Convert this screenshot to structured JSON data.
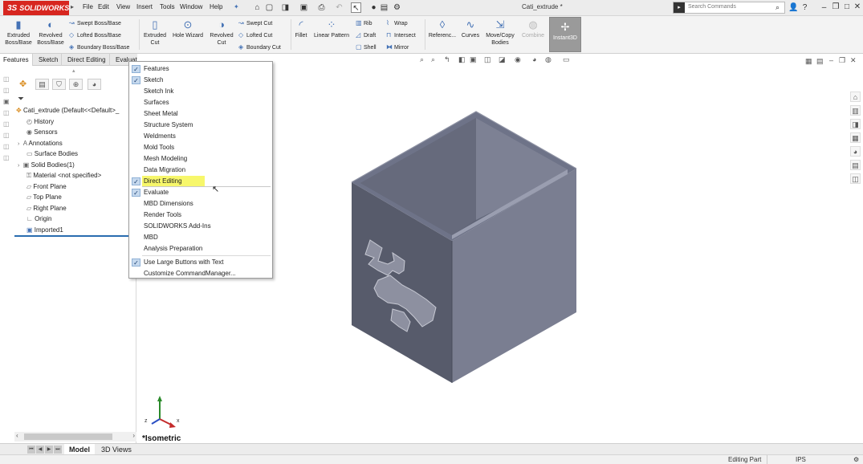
{
  "app": {
    "logo_text": "SOLIDWORKS",
    "logo_prefix": "3S",
    "document_title": "Cati_extrude *",
    "brand_color": "#d7261f"
  },
  "menu": {
    "items": [
      "File",
      "Edit",
      "View",
      "Insert",
      "Tools",
      "Window",
      "Help"
    ],
    "pin_icon": "pin-icon"
  },
  "search": {
    "placeholder": "Search Commands"
  },
  "commands": {
    "extruded_boss": "Extruded\nBoss/Base",
    "revolved_boss": "Revolved\nBoss/Base",
    "swept_boss": "Swept Boss/Base",
    "lofted_boss": "Lofted Boss/Base",
    "boundary_boss": "Boundary Boss/Base",
    "extruded_cut": "Extruded\nCut",
    "hole_wizard": "Hole Wizard",
    "revolved_cut": "Revolved\nCut",
    "swept_cut": "Swept Cut",
    "lofted_cut": "Lofted Cut",
    "boundary_cut": "Boundary Cut",
    "fillet": "Fillet",
    "linear_pattern": "Linear Pattern",
    "rib": "Rib",
    "draft": "Draft",
    "shell": "Shell",
    "wrap": "Wrap",
    "intersect": "Intersect",
    "mirror": "Mirror",
    "reference": "Referenc...",
    "curves": "Curves",
    "move_copy": "Move/Copy\nBodies",
    "combine": "Combine",
    "instant3d": "Instant3D"
  },
  "tabs": [
    "Features",
    "Sketch",
    "Direct Editing",
    "Evaluate"
  ],
  "tree": {
    "root": "Cati_extrude  (Default<<Default>_",
    "items": [
      "History",
      "Sensors",
      "Annotations",
      "Surface Bodies",
      "Solid Bodies(1)",
      "Material <not specified>",
      "Front Plane",
      "Top Plane",
      "Right Plane",
      "Origin",
      "Imported1"
    ]
  },
  "context_menu": {
    "items": [
      {
        "label": "Features",
        "checked": true
      },
      {
        "label": "Sketch",
        "checked": true
      },
      {
        "label": "Sketch Ink",
        "checked": false
      },
      {
        "label": "Surfaces",
        "checked": false
      },
      {
        "label": "Sheet Metal",
        "checked": false
      },
      {
        "label": "Structure System",
        "checked": false
      },
      {
        "label": "Weldments",
        "checked": false
      },
      {
        "label": "Mold Tools",
        "checked": false
      },
      {
        "label": "Mesh Modeling",
        "checked": false
      },
      {
        "label": "Data Migration",
        "checked": false
      },
      {
        "label": "Direct Editing",
        "checked": true
      },
      {
        "label": "Evaluate",
        "checked": true
      },
      {
        "label": "MBD Dimensions",
        "checked": false
      },
      {
        "label": "Render Tools",
        "checked": false
      },
      {
        "label": "SOLIDWORKS Add-Ins",
        "checked": false
      },
      {
        "label": "MBD",
        "checked": false
      },
      {
        "label": "Analysis Preparation",
        "checked": false
      },
      {
        "label": "Use Large Buttons with Text",
        "checked": true
      },
      {
        "label": "Customize CommandManager...",
        "checked": false
      }
    ],
    "highlighted": "Direct Editing",
    "highlight_color": "#f7f76b"
  },
  "viewport": {
    "view_label": "*Isometric",
    "model_color": "#6e7388"
  },
  "bottom_tabs": [
    "Model",
    "3D Views"
  ],
  "status": {
    "mode": "Editing Part",
    "units": "IPS"
  }
}
